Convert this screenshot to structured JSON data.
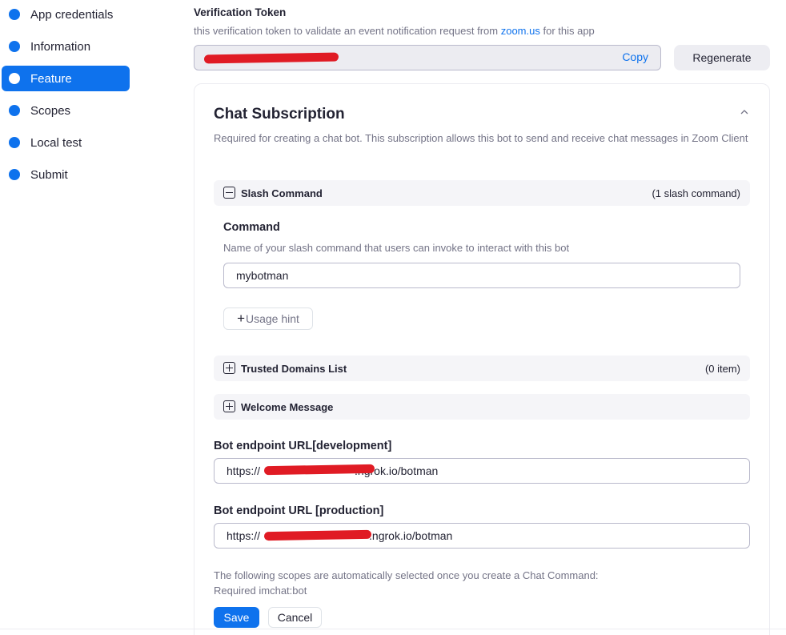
{
  "sidebar": {
    "items": [
      {
        "label": "App credentials",
        "active": false
      },
      {
        "label": "Information",
        "active": false
      },
      {
        "label": "Feature",
        "active": true
      },
      {
        "label": "Scopes",
        "active": false
      },
      {
        "label": "Local test",
        "active": false
      },
      {
        "label": "Submit",
        "active": false
      }
    ]
  },
  "verification": {
    "title": "Verification Token",
    "desc_before": "this verification token to validate an event notification request from ",
    "desc_link": "zoom.us",
    "desc_after": " for this app",
    "copy_label": "Copy",
    "regenerate_label": "Regenerate"
  },
  "chat_subscription": {
    "title": "Chat Subscription",
    "description": "Required for creating a chat bot. This subscription allows this bot to send and receive chat messages in Zoom Client",
    "slash_command": {
      "name": "Slash Command",
      "count": "(1 slash command)",
      "command_label": "Command",
      "command_desc": "Name of your slash command that users can invoke to interact with this bot",
      "command_value": "mybotman",
      "usage_hint_label": "Usage hint"
    },
    "trusted_domains": {
      "name": "Trusted Domains List",
      "count": "(0 item)"
    },
    "welcome_message": {
      "name": "Welcome Message"
    },
    "endpoint_dev": {
      "label": "Bot endpoint URL[development]",
      "prefix": "https://",
      "suffix": ".ngrok.io/botman"
    },
    "endpoint_prod": {
      "label": "Bot endpoint URL [production]",
      "prefix": "https://",
      "suffix": ".ngrok.io/botman"
    },
    "scopes_note_line1": "The following scopes are automatically selected once you create a Chat Command:",
    "scopes_note_line2": "Required imchat:bot",
    "save_label": "Save",
    "cancel_label": "Cancel"
  },
  "colors": {
    "accent": "#0e72ed",
    "redaction": "#e01b24"
  }
}
